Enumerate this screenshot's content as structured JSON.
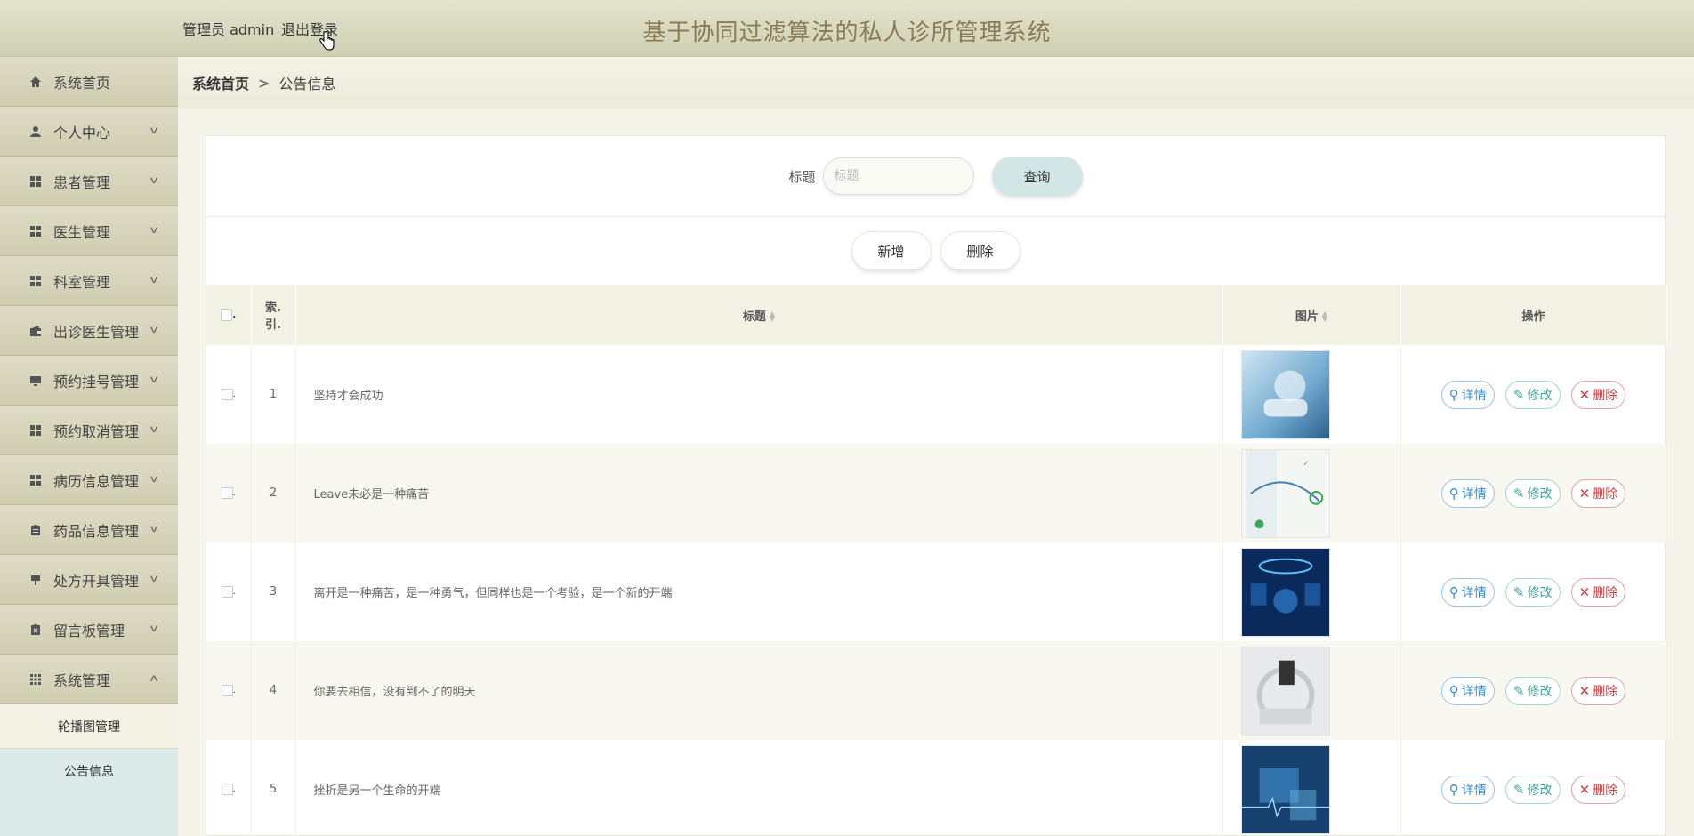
{
  "header": {
    "user_label": "管理员 admin",
    "logout_label": "退出登录",
    "system_title": "基于协同过滤算法的私人诊所管理系统"
  },
  "sidebar": {
    "items": [
      {
        "label": "系统首页",
        "icon": "home-icon"
      },
      {
        "label": "个人中心",
        "icon": "user-icon"
      },
      {
        "label": "患者管理",
        "icon": "grid-icon"
      },
      {
        "label": "医生管理",
        "icon": "grid-icon"
      },
      {
        "label": "科室管理",
        "icon": "grid-icon"
      },
      {
        "label": "出诊医生管理",
        "icon": "wallet-icon"
      },
      {
        "label": "预约挂号管理",
        "icon": "monitor-icon"
      },
      {
        "label": "预约取消管理",
        "icon": "grid-icon"
      },
      {
        "label": "病历信息管理",
        "icon": "grid-icon"
      },
      {
        "label": "药品信息管理",
        "icon": "clipboard-icon"
      },
      {
        "label": "处方开具管理",
        "icon": "sign-icon"
      },
      {
        "label": "留言板管理",
        "icon": "clipboard-x-icon"
      },
      {
        "label": "系统管理",
        "icon": "apps-icon"
      }
    ],
    "sub_items": [
      {
        "label": "轮播图管理"
      },
      {
        "label": "公告信息"
      }
    ]
  },
  "breadcrumb": {
    "home": "系统首页",
    "separator": ">",
    "current": "公告信息"
  },
  "search": {
    "label": "标题",
    "placeholder": "标题",
    "query_button": "查询"
  },
  "actions": {
    "add": "新增",
    "delete": "删除"
  },
  "table": {
    "columns": {
      "index_line1": "索",
      "index_line2": "引.",
      "title": "标题",
      "image": "图片",
      "operation": "操作"
    },
    "rows": [
      {
        "index": "1",
        "title": "坚持才会成功",
        "image_theme": "blue"
      },
      {
        "index": "2",
        "title": "Leave未必是一种痛苦",
        "image_theme": "white-green"
      },
      {
        "index": "3",
        "title": "离开是一种痛苦，是一种勇气，但同样也是一个考验，是一个新的开端",
        "image_theme": "dark-blue"
      },
      {
        "index": "4",
        "title": "你要去相信，没有到不了的明天",
        "image_theme": "gray"
      },
      {
        "index": "5",
        "title": "挫折是另一个生命的开端",
        "image_theme": "navy"
      }
    ],
    "row_actions": {
      "detail": "详情",
      "edit": "修改",
      "delete": "删除"
    }
  },
  "colors": {
    "accent_blue": "#3a8fd5",
    "accent_teal": "#3ca39b",
    "danger": "#d03b3b",
    "title_color": "#8a7a55"
  }
}
